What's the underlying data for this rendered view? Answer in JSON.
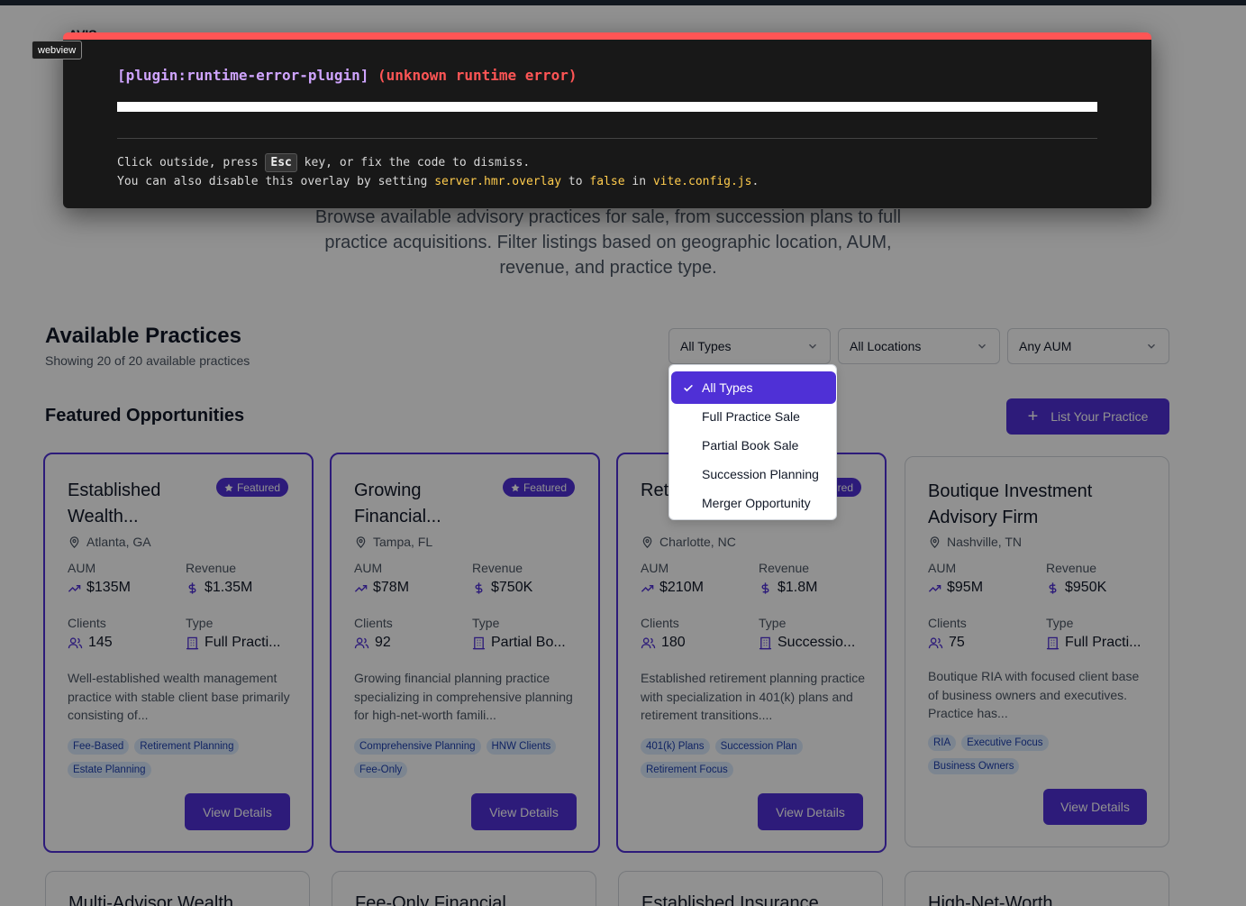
{
  "page": {
    "title_partial": "AVIS",
    "description": "Browse available advisory practices for sale, from succession plans to full practice acquisitions. Filter listings based on geographic location, AUM, revenue, and practice type."
  },
  "section": {
    "title": "Available Practices",
    "subtitle": "Showing 20 of 20 available practices"
  },
  "filters": {
    "type": "All Types",
    "location": "All Locations",
    "aum": "Any AUM"
  },
  "type_dropdown": {
    "options": [
      "All Types",
      "Full Practice Sale",
      "Partial Book Sale",
      "Succession Planning",
      "Merger Opportunity"
    ],
    "selected": "All Types"
  },
  "featured": {
    "title": "Featured Opportunities",
    "list_button": "List Your Practice"
  },
  "labels": {
    "aum": "AUM",
    "revenue": "Revenue",
    "clients": "Clients",
    "type": "Type",
    "view_details": "View Details",
    "featured_badge": "Featured"
  },
  "cards": [
    {
      "title": "Established Wealth...",
      "featured": true,
      "location": "Atlanta, GA",
      "aum": "$135M",
      "revenue": "$1.35M",
      "clients": "145",
      "type": "Full Practi...",
      "description": "Well-established wealth management practice with stable client base primarily consisting of...",
      "tags": [
        "Fee-Based",
        "Retirement Planning",
        "Estate Planning"
      ]
    },
    {
      "title": "Growing Financial...",
      "featured": true,
      "location": "Tampa, FL",
      "aum": "$78M",
      "revenue": "$750K",
      "clients": "92",
      "type": "Partial Bo...",
      "description": "Growing financial planning practice specializing in comprehensive planning for high-net-worth famili...",
      "tags": [
        "Comprehensive Planning",
        "HNW Clients",
        "Fee-Only"
      ]
    },
    {
      "title": "Retirement Plan...",
      "featured": true,
      "location": "Charlotte, NC",
      "aum": "$210M",
      "revenue": "$1.8M",
      "clients": "180",
      "type": "Successio...",
      "description": "Established retirement planning practice with specialization in 401(k) plans and retirement transitions....",
      "tags": [
        "401(k) Plans",
        "Succession Plan",
        "Retirement Focus"
      ]
    },
    {
      "title": "Boutique Investment Advisory Firm",
      "featured": false,
      "location": "Nashville, TN",
      "aum": "$95M",
      "revenue": "$950K",
      "clients": "75",
      "type": "Full Practi...",
      "description": "Boutique RIA with focused client base of business owners and executives. Practice has...",
      "tags": [
        "RIA",
        "Executive Focus",
        "Business Owners"
      ]
    }
  ],
  "cards_row2": [
    {
      "title": "Multi-Advisor Wealth"
    },
    {
      "title": "Fee-Only Financial"
    },
    {
      "title": "Established Insurance"
    },
    {
      "title": "High-Net-Worth"
    }
  ],
  "error_overlay": {
    "plugin": "[plugin:runtime-error-plugin]",
    "message": "(unknown runtime error)",
    "hint_prefix": "Click outside, press ",
    "hint_key": "Esc",
    "hint_suffix": " key, or fix the code to dismiss.",
    "disable_prefix": "You can also disable this overlay by setting ",
    "disable_setting": "server.hmr.overlay",
    "disable_mid": " to ",
    "disable_value": "false",
    "disable_in": " in ",
    "disable_file": "vite.config.js",
    "disable_end": "."
  },
  "tooltip": "webview",
  "colors": {
    "primary": "#4f30d6",
    "error_red": "#ff5555",
    "plugin_purple": "#cfa4ff",
    "code_yellow": "#ffcc4d",
    "tag_bg": "#dbeafe",
    "tag_text": "#1e40af"
  },
  "icons": {
    "location": "map-pin-icon",
    "aum": "trending-up-icon",
    "revenue": "dollar-icon",
    "clients": "users-icon",
    "type": "building-icon",
    "badge": "star-icon",
    "add": "plus-icon",
    "select_chevron": "chevron-down-icon",
    "selected_option": "check-icon"
  }
}
